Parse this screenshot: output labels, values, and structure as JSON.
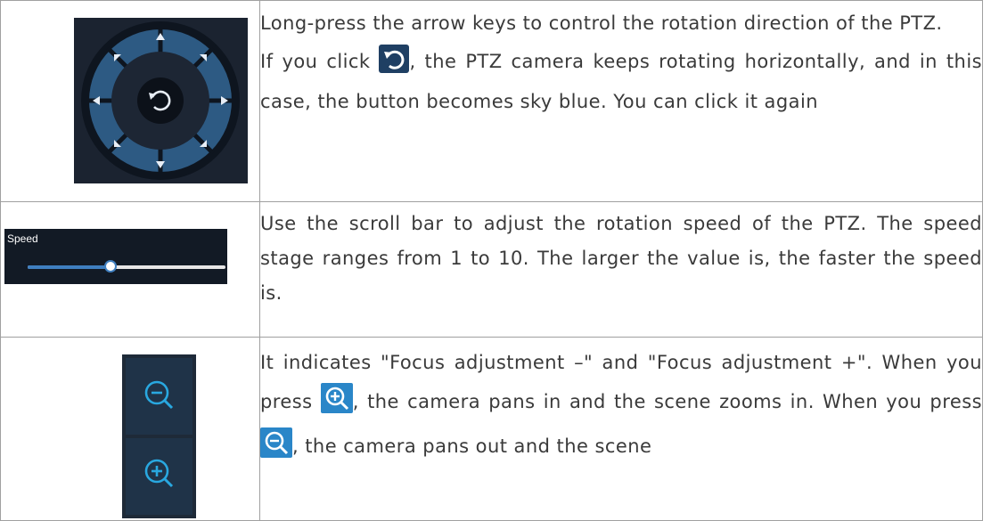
{
  "rows": [
    {
      "line1": "Long-press the arrow keys to control the rotation direction of the PTZ.",
      "line2_before": "If you click ",
      "line2_after": ", the PTZ camera keeps rotating horizontally, and in this case, the button becomes sky blue. You can click it again",
      "icon": "rotate-icon"
    },
    {
      "speed_label": "Speed",
      "speed_level": 0.42,
      "text": "Use the scroll bar to adjust the rotation speed of the PTZ. The speed stage ranges from 1 to 10. The larger the value is, the faster the speed is."
    },
    {
      "t1": "It indicates \"Focus adjustment –\" and \"Focus adjustment +\". When you press ",
      "t2": ", the camera pans in and the scene zooms in. When you press ",
      "t3": ", the camera pans out and the scene",
      "icons": [
        "zoom-in-icon",
        "zoom-out-icon"
      ]
    }
  ],
  "colors": {
    "panel_dark": "#1b2330",
    "accent_blue": "#3f7fc0",
    "icon_cyan": "#29a8e0"
  }
}
